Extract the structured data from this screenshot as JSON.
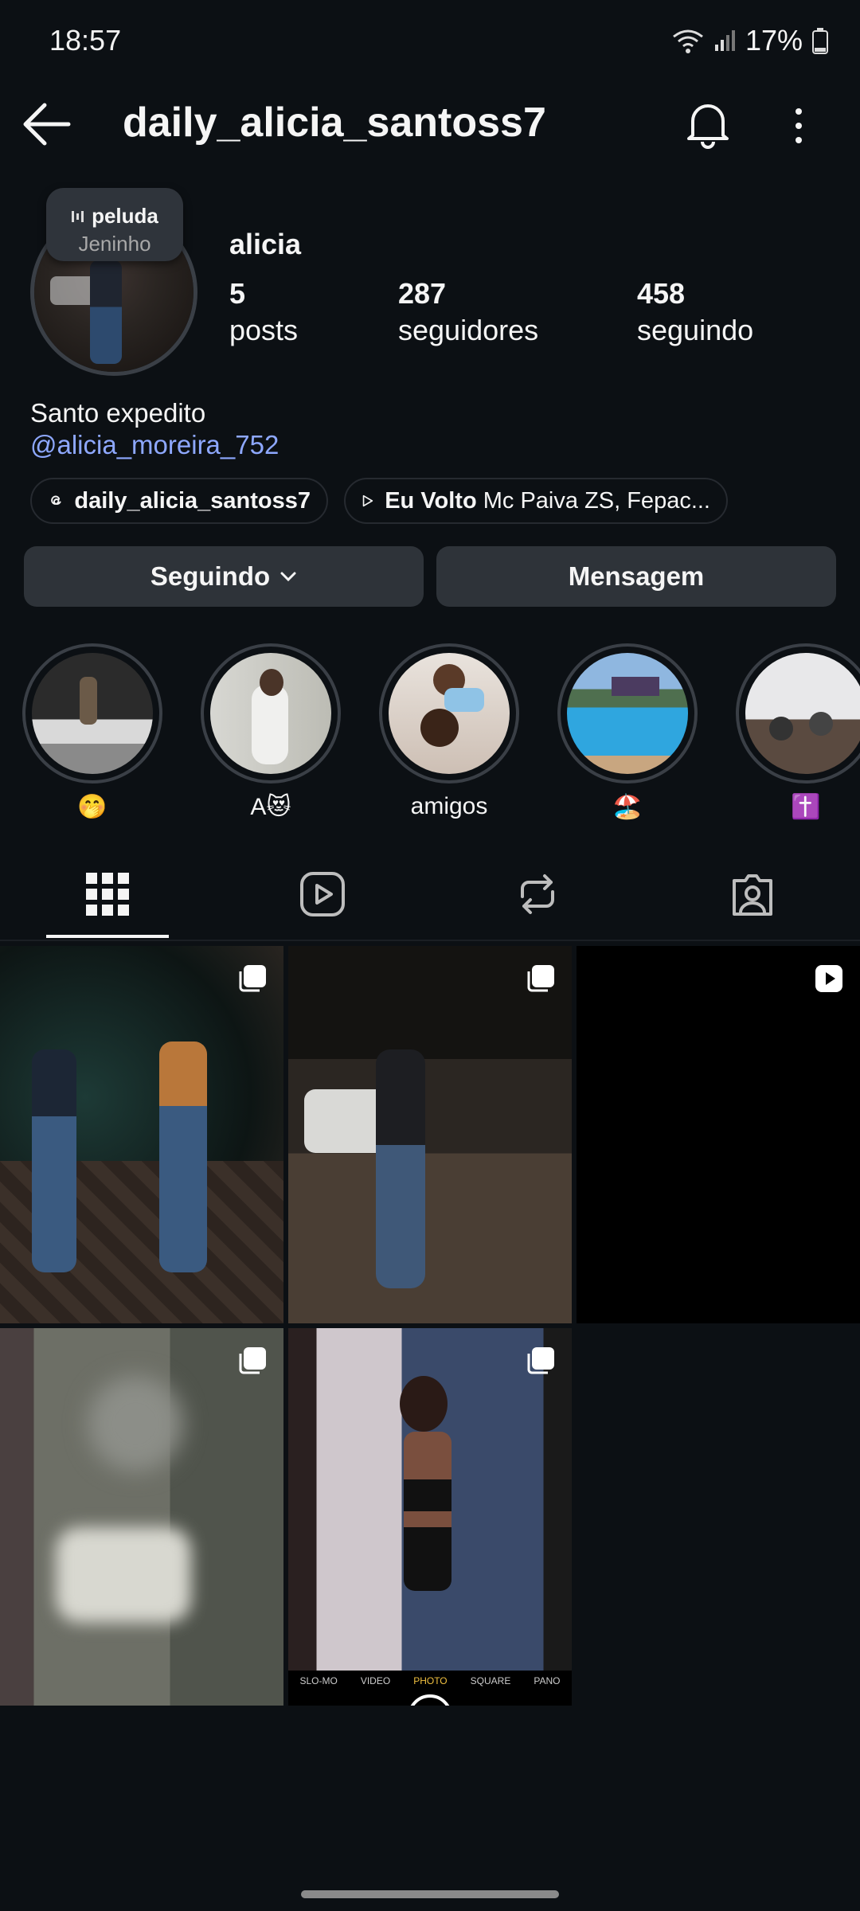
{
  "status": {
    "time": "18:57",
    "battery": "17%"
  },
  "header": {
    "username": "daily_alicia_santoss7"
  },
  "note": {
    "song": "peluda",
    "artist": "Jeninho"
  },
  "profile": {
    "name": "alicia",
    "stats": [
      {
        "value": "5",
        "label": "posts"
      },
      {
        "value": "287",
        "label": "seguidores"
      },
      {
        "value": "458",
        "label": "seguindo"
      }
    ],
    "bio": "Santo expedito",
    "mention": "@alicia_moreira_752"
  },
  "chips": {
    "threads": "daily_alicia_santoss7",
    "music_title": "Eu Volto",
    "music_artist": "Mc Paiva ZS, Fepac..."
  },
  "actions": {
    "following": "Seguindo",
    "message": "Mensagem"
  },
  "highlights": [
    {
      "label": "🤭"
    },
    {
      "label": "A😻"
    },
    {
      "label": "amigos"
    },
    {
      "label": "🏖️"
    },
    {
      "label": "✝️"
    }
  ],
  "tabs": [
    "grid",
    "reels",
    "reposts",
    "tagged"
  ],
  "camera_modes": [
    "SLO-MO",
    "VIDEO",
    "PHOTO",
    "SQUARE",
    "PANO"
  ],
  "colors": {
    "background": "#0c1014",
    "mention": "#8ea8ff",
    "button": "#2e3339"
  }
}
